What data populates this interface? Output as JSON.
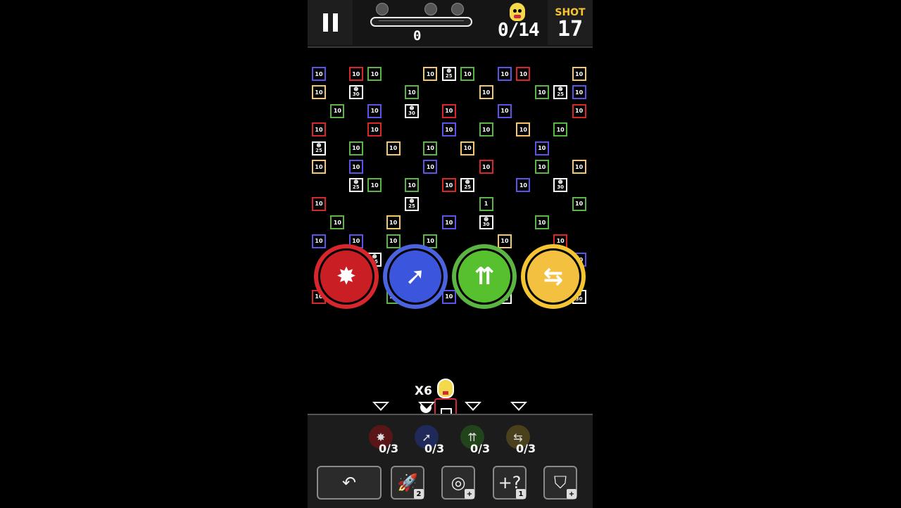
{
  "hud": {
    "score": "0",
    "kills": "0/14",
    "shot_label": "SHOT",
    "shots": "17",
    "progress": 0
  },
  "board": {
    "blocks": [
      {
        "c": "blue",
        "t": "10",
        "col": 0,
        "row": 0
      },
      {
        "c": "red",
        "t": "10",
        "col": 2,
        "row": 0
      },
      {
        "c": "green",
        "t": "10",
        "col": 3,
        "row": 0
      },
      {
        "c": "yellow",
        "t": "10",
        "col": 6,
        "row": 0
      },
      {
        "c": "white",
        "t": "25",
        "col": 7,
        "row": 0
      },
      {
        "c": "green",
        "t": "10",
        "col": 8,
        "row": 0
      },
      {
        "c": "blue",
        "t": "10",
        "col": 10,
        "row": 0
      },
      {
        "c": "red",
        "t": "10",
        "col": 11,
        "row": 0
      },
      {
        "c": "yellow",
        "t": "10",
        "col": 14,
        "row": 0
      },
      {
        "c": "yellow",
        "t": "10",
        "col": 0,
        "row": 1
      },
      {
        "c": "white",
        "t": "30",
        "col": 2,
        "row": 1
      },
      {
        "c": "green",
        "t": "10",
        "col": 5,
        "row": 1
      },
      {
        "c": "yellow",
        "t": "10",
        "col": 9,
        "row": 1
      },
      {
        "c": "green",
        "t": "10",
        "col": 12,
        "row": 1
      },
      {
        "c": "white",
        "t": "25",
        "col": 13,
        "row": 1
      },
      {
        "c": "blue",
        "t": "10",
        "col": 14,
        "row": 1
      },
      {
        "c": "green",
        "t": "10",
        "col": 1,
        "row": 2
      },
      {
        "c": "blue",
        "t": "10",
        "col": 3,
        "row": 2
      },
      {
        "c": "white",
        "t": "30",
        "col": 5,
        "row": 2
      },
      {
        "c": "red",
        "t": "10",
        "col": 7,
        "row": 2
      },
      {
        "c": "blue",
        "t": "10",
        "col": 10,
        "row": 2
      },
      {
        "c": "red",
        "t": "10",
        "col": 14,
        "row": 2
      },
      {
        "c": "red",
        "t": "10",
        "col": 0,
        "row": 3
      },
      {
        "c": "red",
        "t": "10",
        "col": 3,
        "row": 3
      },
      {
        "c": "blue",
        "t": "10",
        "col": 7,
        "row": 3
      },
      {
        "c": "green",
        "t": "10",
        "col": 9,
        "row": 3
      },
      {
        "c": "yellow",
        "t": "10",
        "col": 11,
        "row": 3
      },
      {
        "c": "green",
        "t": "10",
        "col": 13,
        "row": 3
      },
      {
        "c": "white",
        "t": "25",
        "col": 0,
        "row": 4
      },
      {
        "c": "green",
        "t": "10",
        "col": 2,
        "row": 4
      },
      {
        "c": "yellow",
        "t": "10",
        "col": 4,
        "row": 4
      },
      {
        "c": "green",
        "t": "10",
        "col": 6,
        "row": 4
      },
      {
        "c": "yellow",
        "t": "10",
        "col": 8,
        "row": 4
      },
      {
        "c": "blue",
        "t": "10",
        "col": 12,
        "row": 4
      },
      {
        "c": "yellow",
        "t": "10",
        "col": 0,
        "row": 5
      },
      {
        "c": "blue",
        "t": "10",
        "col": 2,
        "row": 5
      },
      {
        "c": "blue",
        "t": "10",
        "col": 6,
        "row": 5
      },
      {
        "c": "red",
        "t": "10",
        "col": 9,
        "row": 5
      },
      {
        "c": "green",
        "t": "10",
        "col": 12,
        "row": 5
      },
      {
        "c": "yellow",
        "t": "10",
        "col": 14,
        "row": 5
      },
      {
        "c": "white",
        "t": "25",
        "col": 2,
        "row": 6
      },
      {
        "c": "green",
        "t": "10",
        "col": 3,
        "row": 6
      },
      {
        "c": "green",
        "t": "10",
        "col": 5,
        "row": 6
      },
      {
        "c": "red",
        "t": "10",
        "col": 7,
        "row": 6
      },
      {
        "c": "white",
        "t": "25",
        "col": 8,
        "row": 6
      },
      {
        "c": "blue",
        "t": "10",
        "col": 11,
        "row": 6
      },
      {
        "c": "white",
        "t": "30",
        "col": 13,
        "row": 6
      },
      {
        "c": "red",
        "t": "10",
        "col": 0,
        "row": 7
      },
      {
        "c": "white",
        "t": "25",
        "col": 5,
        "row": 7
      },
      {
        "c": "green",
        "t": "1",
        "col": 9,
        "row": 7
      },
      {
        "c": "green",
        "t": "10",
        "col": 14,
        "row": 7
      },
      {
        "c": "green",
        "t": "10",
        "col": 1,
        "row": 8
      },
      {
        "c": "yellow",
        "t": "10",
        "col": 4,
        "row": 8
      },
      {
        "c": "blue",
        "t": "10",
        "col": 7,
        "row": 8
      },
      {
        "c": "white",
        "t": "30",
        "col": 9,
        "row": 8
      },
      {
        "c": "green",
        "t": "10",
        "col": 12,
        "row": 8
      },
      {
        "c": "blue",
        "t": "10",
        "col": 0,
        "row": 9
      },
      {
        "c": "blue",
        "t": "10",
        "col": 2,
        "row": 9
      },
      {
        "c": "green",
        "t": "10",
        "col": 4,
        "row": 9
      },
      {
        "c": "green",
        "t": "10",
        "col": 6,
        "row": 9
      },
      {
        "c": "yellow",
        "t": "10",
        "col": 10,
        "row": 9
      },
      {
        "c": "red",
        "t": "10",
        "col": 13,
        "row": 9
      },
      {
        "c": "white",
        "t": "25",
        "col": 3,
        "row": 10
      },
      {
        "c": "blue",
        "t": "10",
        "col": 14,
        "row": 10
      },
      {
        "c": "red",
        "t": "10",
        "col": 0,
        "row": 12
      },
      {
        "c": "green",
        "t": "10",
        "col": 4,
        "row": 12
      },
      {
        "c": "blue",
        "t": "10",
        "col": 7,
        "row": 12
      },
      {
        "c": "white",
        "t": "30",
        "col": 10,
        "row": 12
      },
      {
        "c": "white",
        "t": "30",
        "col": 14,
        "row": 12
      }
    ]
  },
  "powers": [
    {
      "name": "burst",
      "glyph": "✸",
      "ring": "#d8262d",
      "fill": "#c81e24"
    },
    {
      "name": "arrow",
      "glyph": "➚",
      "ring": "#4c63e0",
      "fill": "#3b55dd"
    },
    {
      "name": "spread",
      "glyph": "⇈",
      "ring": "#5bb543",
      "fill": "#57c02f"
    },
    {
      "name": "sideways",
      "glyph": "⇆",
      "ring": "#f5c431",
      "fill": "#f3c03f"
    }
  ],
  "player": {
    "multiplier": "X6"
  },
  "slots": [
    {
      "glyph": "✸",
      "count": "0/3",
      "bg": "#5a1519"
    },
    {
      "glyph": "➚",
      "count": "0/3",
      "bg": "#1f2a5a"
    },
    {
      "glyph": "⇈",
      "count": "0/3",
      "bg": "#21441a"
    },
    {
      "glyph": "⇆",
      "count": "0/3",
      "bg": "#4a401c"
    }
  ],
  "tools": [
    {
      "name": "undo",
      "glyph": "↶",
      "badge": ""
    },
    {
      "name": "rocket",
      "glyph": "🚀",
      "badge": "2"
    },
    {
      "name": "target",
      "glyph": "◎",
      "badge": "+"
    },
    {
      "name": "random",
      "glyph": "+?",
      "badge": "1"
    },
    {
      "name": "shield",
      "glyph": "⛉",
      "badge": "+"
    }
  ]
}
